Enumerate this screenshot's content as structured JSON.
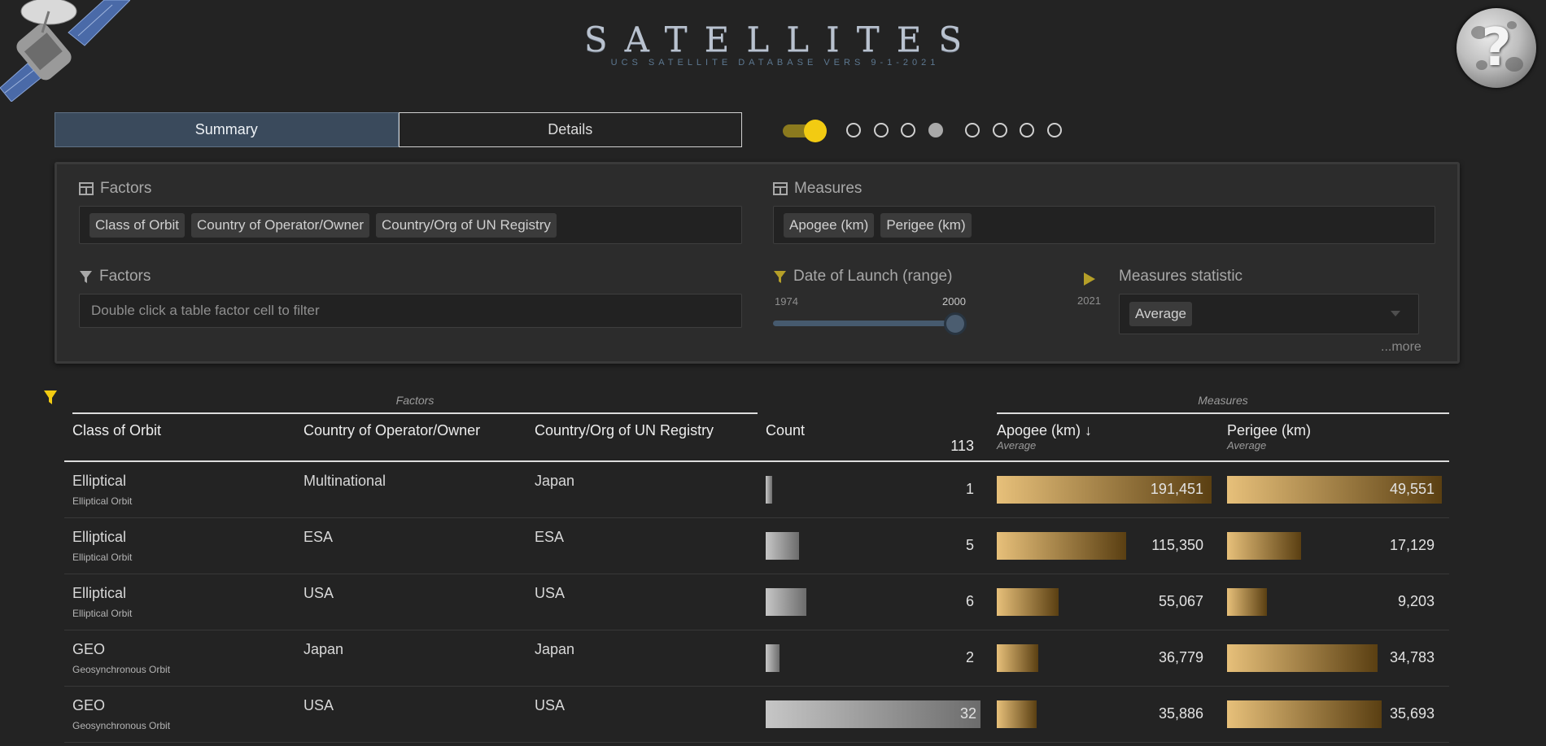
{
  "header": {
    "title": "SATELLITES",
    "subtitle": "UCS SATELLITE DATABASE VERS 9-1-2021"
  },
  "tabs": [
    {
      "label": "Summary",
      "active": true
    },
    {
      "label": "Details",
      "active": false
    }
  ],
  "toggle": {
    "on": true
  },
  "page_dots": {
    "total": 8,
    "active_index": 3
  },
  "panel": {
    "factors_label": "Factors",
    "factors_chips": [
      "Class of Orbit",
      "Country of Operator/Owner",
      "Country/Org of UN Registry"
    ],
    "measures_label": "Measures",
    "measures_chips": [
      "Apogee (km)",
      "Perigee (km)"
    ],
    "filter_label": "Factors",
    "filter_placeholder": "Double click a table factor cell to filter",
    "date_label": "Date of Launch (range)",
    "date_min": "1974",
    "date_value": "2000",
    "date_max": "2021",
    "statistic_label": "Measures statistic",
    "statistic_value": "Average",
    "more_label": "...more"
  },
  "table": {
    "factors_group": "Factors",
    "measures_group": "Measures",
    "headers": {
      "class": "Class of Orbit",
      "operator": "Country of Operator/Owner",
      "registry": "Country/Org of UN Registry",
      "count": "Count",
      "count_total": "113",
      "apogee": "Apogee (km) ↓",
      "apogee_stat": "Average",
      "perigee": "Perigee (km)",
      "perigee_stat": "Average"
    },
    "rows": [
      {
        "class": "Elliptical",
        "class_sub": "Elliptical Orbit",
        "operator": "Multinational",
        "registry": "Japan",
        "count": 1,
        "count_label": "1",
        "apogee": 191451,
        "apogee_label": "191,451",
        "perigee": 49551,
        "perigee_label": "49,551"
      },
      {
        "class": "Elliptical",
        "class_sub": "Elliptical Orbit",
        "operator": "ESA",
        "registry": "ESA",
        "count": 5,
        "count_label": "5",
        "apogee": 115350,
        "apogee_label": "115,350",
        "perigee": 17129,
        "perigee_label": "17,129"
      },
      {
        "class": "Elliptical",
        "class_sub": "Elliptical Orbit",
        "operator": "USA",
        "registry": "USA",
        "count": 6,
        "count_label": "6",
        "apogee": 55067,
        "apogee_label": "55,067",
        "perigee": 9203,
        "perigee_label": "9,203"
      },
      {
        "class": "GEO",
        "class_sub": "Geosynchronous Orbit",
        "operator": "Japan",
        "registry": "Japan",
        "count": 2,
        "count_label": "2",
        "apogee": 36779,
        "apogee_label": "36,779",
        "perigee": 34783,
        "perigee_label": "34,783"
      },
      {
        "class": "GEO",
        "class_sub": "Geosynchronous Orbit",
        "operator": "USA",
        "registry": "USA",
        "count": 32,
        "count_label": "32",
        "apogee": 35886,
        "apogee_label": "35,886",
        "perigee": 35693,
        "perigee_label": "35,693"
      }
    ]
  }
}
